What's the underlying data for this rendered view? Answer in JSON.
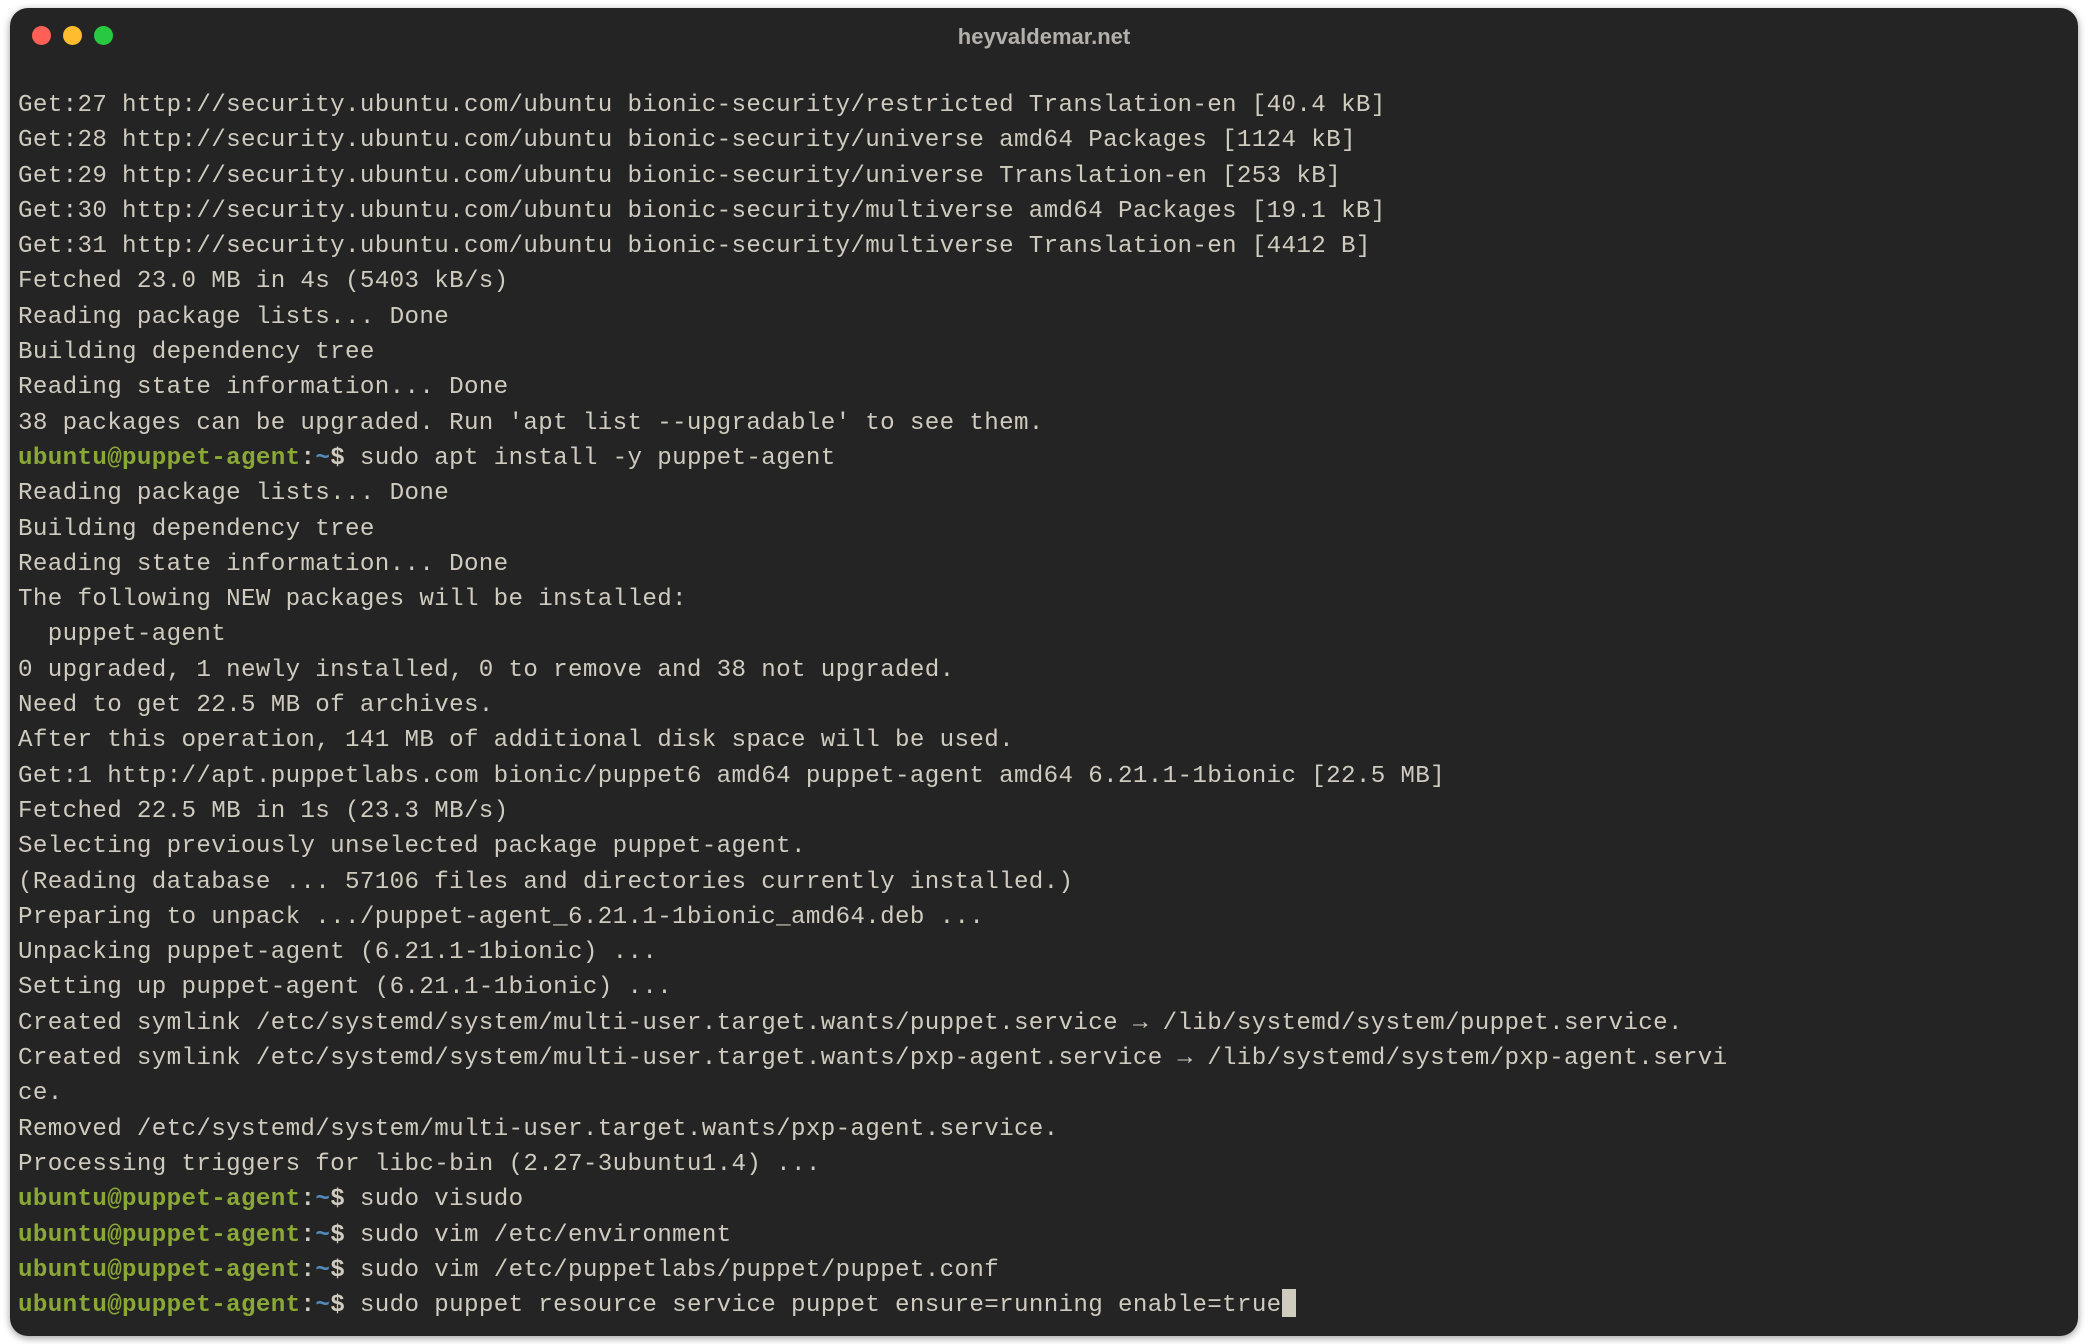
{
  "window": {
    "title": "heyvaldemar.net"
  },
  "terminal": {
    "lines": [
      "Get:27 http://security.ubuntu.com/ubuntu bionic-security/restricted Translation-en [40.4 kB]",
      "Get:28 http://security.ubuntu.com/ubuntu bionic-security/universe amd64 Packages [1124 kB]",
      "Get:29 http://security.ubuntu.com/ubuntu bionic-security/universe Translation-en [253 kB]",
      "Get:30 http://security.ubuntu.com/ubuntu bionic-security/multiverse amd64 Packages [19.1 kB]",
      "Get:31 http://security.ubuntu.com/ubuntu bionic-security/multiverse Translation-en [4412 B]",
      "Fetched 23.0 MB in 4s (5403 kB/s)",
      "Reading package lists... Done",
      "Building dependency tree",
      "Reading state information... Done",
      "38 packages can be upgraded. Run 'apt list --upgradable' to see them."
    ],
    "prompts": [
      {
        "user": "ubuntu@puppet-agent",
        "sep": ":",
        "path": "~",
        "dollar": "$ ",
        "command": "sudo apt install -y puppet-agent"
      }
    ],
    "lines2": [
      "Reading package lists... Done",
      "Building dependency tree",
      "Reading state information... Done",
      "The following NEW packages will be installed:",
      "  puppet-agent",
      "0 upgraded, 1 newly installed, 0 to remove and 38 not upgraded.",
      "Need to get 22.5 MB of archives.",
      "After this operation, 141 MB of additional disk space will be used.",
      "Get:1 http://apt.puppetlabs.com bionic/puppet6 amd64 puppet-agent amd64 6.21.1-1bionic [22.5 MB]",
      "Fetched 22.5 MB in 1s (23.3 MB/s)",
      "Selecting previously unselected package puppet-agent.",
      "(Reading database ... 57106 files and directories currently installed.)",
      "Preparing to unpack .../puppet-agent_6.21.1-1bionic_amd64.deb ...",
      "Unpacking puppet-agent (6.21.1-1bionic) ...",
      "Setting up puppet-agent (6.21.1-1bionic) ...",
      "Created symlink /etc/systemd/system/multi-user.target.wants/puppet.service → /lib/systemd/system/puppet.service.",
      "Created symlink /etc/systemd/system/multi-user.target.wants/pxp-agent.service → /lib/systemd/system/pxp-agent.servi",
      "ce.",
      "Removed /etc/systemd/system/multi-user.target.wants/pxp-agent.service.",
      "Processing triggers for libc-bin (2.27-3ubuntu1.4) ..."
    ],
    "prompts2": [
      {
        "user": "ubuntu@puppet-agent",
        "sep": ":",
        "path": "~",
        "dollar": "$ ",
        "command": "sudo visudo"
      },
      {
        "user": "ubuntu@puppet-agent",
        "sep": ":",
        "path": "~",
        "dollar": "$ ",
        "command": "sudo vim /etc/environment"
      },
      {
        "user": "ubuntu@puppet-agent",
        "sep": ":",
        "path": "~",
        "dollar": "$ ",
        "command": "sudo vim /etc/puppetlabs/puppet/puppet.conf"
      },
      {
        "user": "ubuntu@puppet-agent",
        "sep": ":",
        "path": "~",
        "dollar": "$ ",
        "command": "sudo puppet resource service puppet ensure=running enable=true"
      }
    ]
  }
}
